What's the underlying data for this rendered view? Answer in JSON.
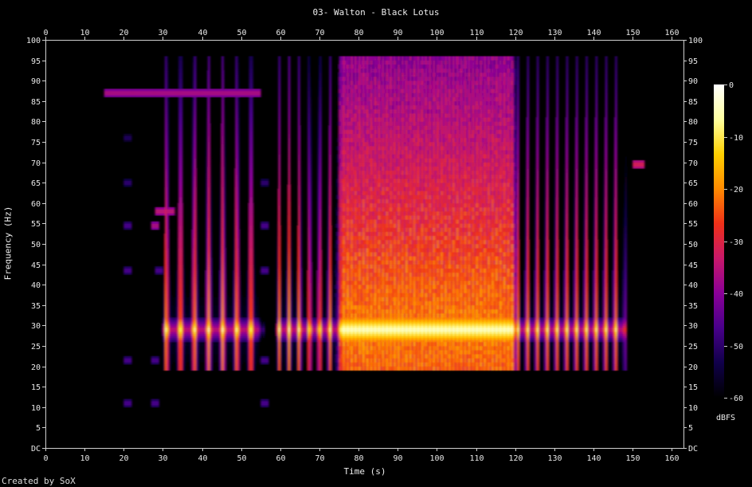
{
  "chart_data": {
    "type": "heatmap",
    "title": "03- Walton - Black Lotus",
    "xlabel": "Time (s)",
    "ylabel": "Frequency (Hz)",
    "xlim": [
      0,
      163
    ],
    "ylim": [
      0,
      100
    ],
    "x_ticks": [
      "0",
      "10",
      "20",
      "30",
      "40",
      "50",
      "60",
      "70",
      "80",
      "90",
      "100",
      "110",
      "120",
      "130",
      "140",
      "150",
      "160"
    ],
    "y_ticks": [
      "DC",
      "5",
      "10",
      "15",
      "20",
      "25",
      "30",
      "35",
      "40",
      "45",
      "50",
      "55",
      "60",
      "65",
      "70",
      "75",
      "80",
      "85",
      "90",
      "95",
      "100"
    ],
    "colorbar": {
      "label": "dBFS",
      "ticks": [
        "0",
        "-10",
        "-20",
        "-30",
        "-40",
        "-50",
        "-60"
      ],
      "range": [
        -60,
        0
      ],
      "colors": [
        "#000000",
        "#10004a",
        "#48008a",
        "#8a0098",
        "#c8186a",
        "#f03018",
        "#ff8a00",
        "#ffd000",
        "#ffffa0",
        "#ffffff"
      ]
    },
    "segments": [
      {
        "start": 30,
        "end": 55,
        "pulse_period": 3.6,
        "peak_db": -4
      },
      {
        "start": 59,
        "end": 75,
        "pulse_period": 2.6,
        "peak_db": -4
      },
      {
        "start": 75,
        "end": 120,
        "pulse_period": 1.0,
        "peak_db": -2
      },
      {
        "start": 120,
        "end": 148,
        "pulse_period": 2.5,
        "peak_db": -4
      }
    ],
    "fundamental_hz": 29,
    "sparse_notes": [
      {
        "t": 15,
        "f": 87,
        "db": -35,
        "dur": 40
      },
      {
        "t": 28,
        "f": 58,
        "db": -33,
        "dur": 5
      },
      {
        "t": 20,
        "f": 43.5,
        "db": -45,
        "dur": 2
      },
      {
        "t": 28,
        "f": 43.5,
        "db": -45,
        "dur": 2
      },
      {
        "t": 20,
        "f": 54.5,
        "db": -45,
        "dur": 2
      },
      {
        "t": 27,
        "f": 54.5,
        "db": -35,
        "dur": 2
      },
      {
        "t": 20,
        "f": 21.5,
        "db": -45,
        "dur": 2
      },
      {
        "t": 27,
        "f": 21.5,
        "db": -45,
        "dur": 2
      },
      {
        "t": 20,
        "f": 11,
        "db": -45,
        "dur": 2
      },
      {
        "t": 27,
        "f": 11,
        "db": -45,
        "dur": 2
      },
      {
        "t": 55,
        "f": 11,
        "db": -45,
        "dur": 2
      },
      {
        "t": 55,
        "f": 21.5,
        "db": -45,
        "dur": 2
      },
      {
        "t": 55,
        "f": 43.5,
        "db": -45,
        "dur": 2
      },
      {
        "t": 55,
        "f": 54.5,
        "db": -45,
        "dur": 2
      },
      {
        "t": 55,
        "f": 65,
        "db": -48,
        "dur": 2
      },
      {
        "t": 20,
        "f": 65,
        "db": -48,
        "dur": 2
      },
      {
        "t": 20,
        "f": 76,
        "db": -50,
        "dur": 2
      },
      {
        "t": 150,
        "f": 69.5,
        "db": -30,
        "dur": 3
      }
    ]
  },
  "credit": "Created by SoX"
}
